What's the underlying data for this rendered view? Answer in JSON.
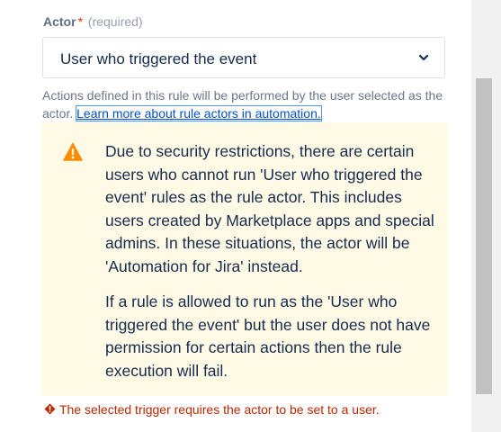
{
  "actor_field": {
    "label": "Actor",
    "required_star": "*",
    "required_text": "(required)",
    "selected_value": "User who triggered the event",
    "help_text": "Actions defined in this rule will be performed by the user selected as the actor.",
    "help_link": "Learn more about rule actors in automation."
  },
  "warning": {
    "paragraph1": "Due to security restrictions, there are certain users who cannot run 'User who triggered the event' rules as the rule actor. This includes users created by Marketplace apps and special admins. In these situations, the actor will be 'Automation for Jira' instead.",
    "paragraph2": "If a rule is allowed to run as the 'User who triggered the event' but the user does not have permission for certain actions then the rule execution will fail.",
    "icon": "warning-triangle-icon",
    "color": "#fffae6",
    "icon_color": "#ff8b00"
  },
  "error": {
    "message": "The selected trigger requires the actor to be set to a user.",
    "icon": "error-icon",
    "color": "#bf2600"
  },
  "colors": {
    "link": "#0052cc",
    "text": "#172b4d",
    "muted": "#6b778c"
  }
}
